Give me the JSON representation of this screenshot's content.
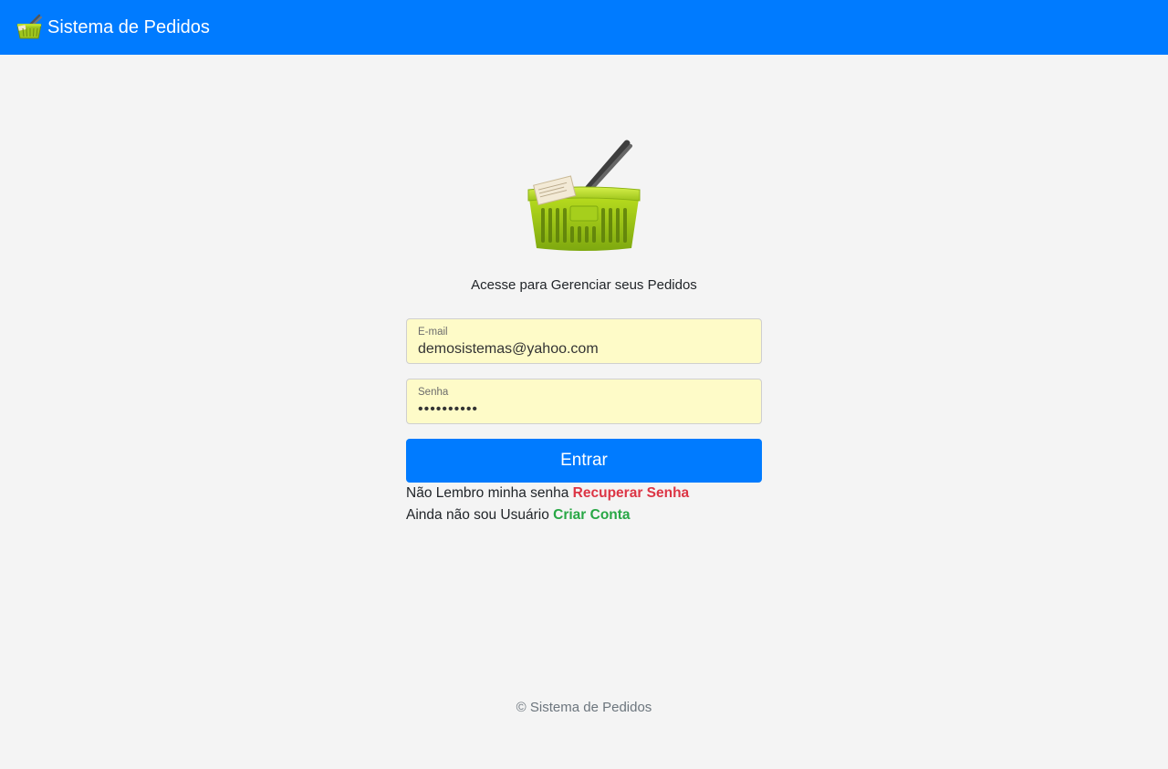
{
  "app": {
    "brand": "Sistema de Pedidos",
    "brand_icon": "shopping-basket-icon"
  },
  "login": {
    "subtitle": "Acesse para Gerenciar seus Pedidos",
    "email_label": "E-mail",
    "email_value": "demosistemas@yahoo.com",
    "password_label": "Senha",
    "password_value": "••••••••••",
    "submit_label": "Entrar",
    "forgot_text": "Não Lembro minha senha",
    "forgot_link": "Recuperar Senha",
    "signup_text": "Ainda não sou Usuário",
    "signup_link": "Criar Conta"
  },
  "footer": {
    "text": "© Sistema de Pedidos"
  },
  "colors": {
    "primary": "#007bff",
    "danger": "#dc3545",
    "success": "#28a745",
    "autofill": "#fefbc8",
    "background": "#f4f4f4"
  }
}
